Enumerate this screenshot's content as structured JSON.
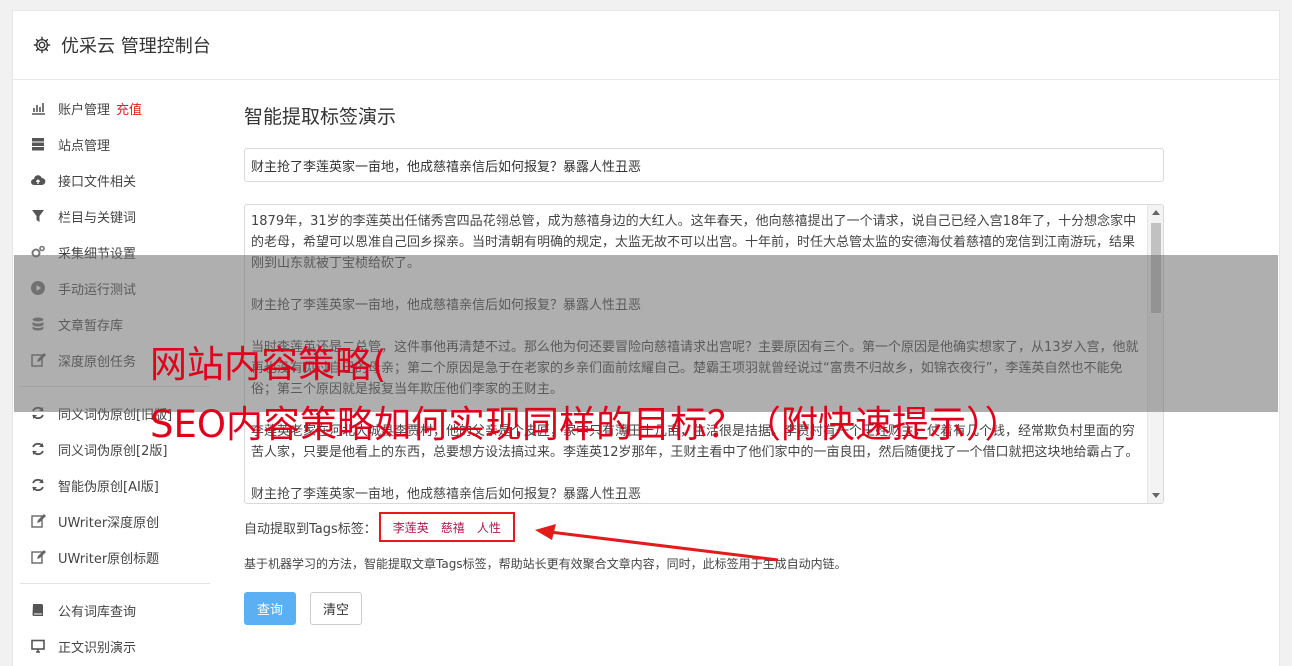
{
  "header": {
    "title": "优采云 管理控制台"
  },
  "sidebar": {
    "group1": [
      {
        "icon": "bar-chart-icon",
        "label": "账户管理",
        "badge": "充值"
      },
      {
        "icon": "server-icon",
        "label": "站点管理"
      },
      {
        "icon": "cloud-upload-icon",
        "label": "接口文件相关"
      },
      {
        "icon": "filter-icon",
        "label": "栏目与关键词"
      },
      {
        "icon": "gears-icon",
        "label": "采集细节设置"
      },
      {
        "icon": "play-circle-icon",
        "label": "手动运行测试"
      },
      {
        "icon": "database-icon",
        "label": "文章暂存库"
      },
      {
        "icon": "edit-icon",
        "label": "深度原创任务"
      }
    ],
    "group2": [
      {
        "icon": "refresh-icon",
        "label": "同义词伪原创[旧版]"
      },
      {
        "icon": "refresh-icon",
        "label": "同义词伪原创[2版]"
      },
      {
        "icon": "refresh-icon",
        "label": "智能伪原创[AI版]"
      },
      {
        "icon": "edit-icon",
        "label": "UWriter深度原创"
      },
      {
        "icon": "edit-icon",
        "label": "UWriter原创标题"
      }
    ],
    "group3": [
      {
        "icon": "book-icon",
        "label": "公有词库查询"
      },
      {
        "icon": "monitor-icon",
        "label": "正文识别演示"
      }
    ]
  },
  "main": {
    "heading": "智能提取标签演示",
    "title_value": "财主抢了李莲英家一亩地，他成慈禧亲信后如何报复？暴露人性丑恶",
    "content": "1879年，31岁的李莲英出任储秀宫四品花翎总管，成为慈禧身边的大红人。这年春天，他向慈禧提出了一个请求，说自己已经入宫18年了，十分想念家中的老母，希望可以恩准自己回乡探亲。当时清朝有明确的规定，太监无故不可以出宫。十年前，时任大总管太监的安德海仗着慈禧的宠信到江南游玩，结果刚到山东就被丁宝桢给砍了。\n\n财主抢了李莲英家一亩地，他成慈禧亲信后如何报复？暴露人性丑恶\n\n当时李莲英还是二总管，这件事他再清楚不过。那么他为何还要冒险向慈禧请求出宫呢？主要原因有三个。第一个原因是他确实想家了，从13岁入宫，他就再也没有见过自己的母亲；第二个原因是急于在老家的乡亲们面前炫耀自己。楚霸王项羽就曾经说过“富贵不归故乡，如锦衣夜行”，李莲英自然也不能免俗；第三个原因就是报复当年欺压他们李家的王财主。\n\n李莲英老家在河北大城县李贾村，他的父亲是个皮匠，家中只有薄田十几亩，生活很是拮据。李贾村有一个王姓财主，仗着有几个钱，经常欺负村里面的穷苦人家，只要是他看上的东西，总要想方设法搞过来。李莲英12岁那年，王财主看中了他们家中的一亩良田，然后随便找了一个借口就把这块地给霸占了。\n\n财主抢了李莲英家一亩地，他成慈禧亲信后如何报复？暴露人性丑恶",
    "tags_label": "自动提取到Tags标签：",
    "tags": [
      "李莲英",
      "慈禧",
      "人性"
    ],
    "description": "基于机器学习的方法，智能提取文章Tags标签，帮助站长更有效聚合文章内容，同时，此标签用于生成自动内链。",
    "query_button": "查询",
    "clear_button": "清空"
  },
  "banner": {
    "line1": "网站内容策略(",
    "line2": "SEO内容策略如何实现同样的目标？（附快速提示））"
  },
  "colors": {
    "accent": "#5bb0f3",
    "highlight": "#e31b1b",
    "tag": "#b0174d"
  }
}
